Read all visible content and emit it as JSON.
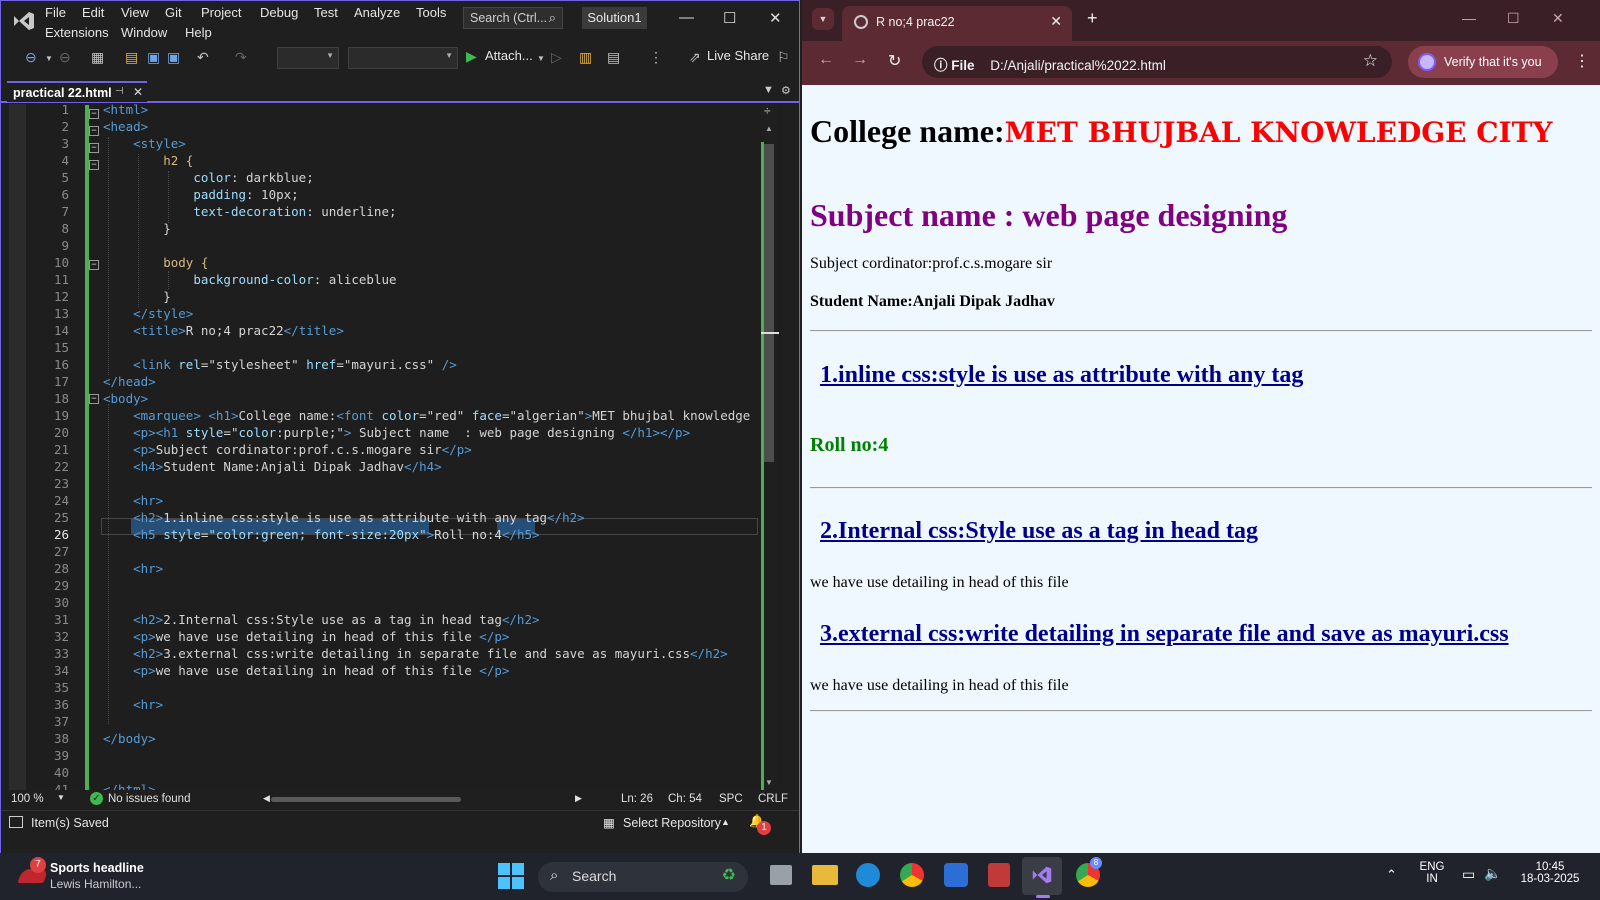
{
  "vs": {
    "menu": [
      "File",
      "Edit",
      "View",
      "Git",
      "Project",
      "Debug",
      "Test",
      "Analyze",
      "Tools",
      "Extensions",
      "Window",
      "Help"
    ],
    "search_placeholder": "Search (Ctrl...",
    "solution_label": "Solution1",
    "attach_label": "Attach...",
    "live_share_label": "Live Share",
    "doc_tab": "practical 22.html",
    "line_numbers": [
      "1",
      "2",
      "3",
      "4",
      "5",
      "6",
      "7",
      "8",
      "9",
      "10",
      "11",
      "12",
      "13",
      "14",
      "15",
      "16",
      "17",
      "18",
      "19",
      "20",
      "21",
      "22",
      "23",
      "24",
      "25",
      "26",
      "27",
      "28",
      "29",
      "30",
      "31",
      "32",
      "33",
      "34",
      "35",
      "36",
      "37",
      "38",
      "39",
      "40",
      "41"
    ],
    "code": {
      "l1": [
        "<html>"
      ],
      "l2": [
        "<head>"
      ],
      "l3": [
        "<style>"
      ],
      "l4": [
        "h2 {"
      ],
      "l5": [
        "color",
        ": darkblue;"
      ],
      "l6": [
        "padding",
        ": 10px;"
      ],
      "l7": [
        "text-decoration",
        ": underline;"
      ],
      "l8": [
        "}"
      ],
      "l10": [
        "body {"
      ],
      "l11": [
        "background-color",
        ": aliceblue"
      ],
      "l12": [
        "}"
      ],
      "l13": [
        "</style>"
      ],
      "l14": [
        "<title>",
        "R no;4 prac22",
        "</title>"
      ],
      "l16": [
        "<link ",
        "rel",
        "=",
        "\"stylesheet\"",
        " href",
        "=",
        "\"mayuri.css\"",
        " />"
      ],
      "l17": [
        "</head>"
      ],
      "l18": [
        "<body>"
      ],
      "l19": [
        "<marquee>",
        " <h1>",
        "College name:",
        "<font ",
        "color",
        "=",
        "\"red\"",
        " face",
        "=",
        "\"algerian\"",
        ">",
        "MET bhujbal knowledge c"
      ],
      "l20": [
        "<p>",
        "<h1 ",
        "style",
        "=",
        "\"",
        "color",
        ":",
        "purple",
        ";\"",
        ">",
        " Subject name  : web page designing ",
        "</h1>",
        "</p>"
      ],
      "l21": [
        "<p>",
        "Subject cordinator:prof.c.s.mogare sir",
        "</p>"
      ],
      "l22": [
        "<h4>",
        "Student Name:Anjali Dipak Jadhav",
        "</h4>"
      ],
      "l24": [
        "<hr>"
      ],
      "l25": [
        "<h2>",
        "1.inline css:style is use as attribute with any tag",
        "</h2>"
      ],
      "l26": [
        "<h5 ",
        "style",
        "=",
        "\"color:green; font-size:20px\"",
        ">",
        "Roll no:4",
        "</h5>"
      ],
      "l28": [
        "<hr>"
      ],
      "l31": [
        "<h2>",
        "2.Internal css:Style use as a tag in head tag",
        "</h2>"
      ],
      "l32": [
        "<p>",
        "we have use detailing in head of this file ",
        "</p>"
      ],
      "l33": [
        "<h2>",
        "3.external css:write detailing in separate file and save as mayuri.css",
        "</h2>"
      ],
      "l34": [
        "<p>",
        "we have use detailing in head of this file ",
        "</p>"
      ],
      "l36": [
        "<hr>"
      ],
      "l38": [
        "</body>"
      ],
      "l41": [
        "</html>"
      ]
    },
    "status": {
      "zoom": "100 %",
      "issues": "No issues found",
      "ln": "Ln: 26",
      "ch": "Ch: 54",
      "spc": "SPC",
      "crlf": "CRLF"
    },
    "bottom": {
      "saved": "Item(s) Saved",
      "repo": "Select Repository",
      "notif_count": "1"
    }
  },
  "browser": {
    "tab_title": "R no;4 prac22",
    "url_scheme": "File",
    "url": "D:/Anjali/practical%2022.html",
    "verify_label": "Verify that it's you",
    "page": {
      "college_prefix": "College name:",
      "college_name": "MET BHUJBAL KNOWLEDGE CITY",
      "subject": "Subject name : web page designing",
      "coordinator": "Subject cordinator:prof.c.s.mogare sir",
      "student": "Student Name:Anjali Dipak Jadhav",
      "h2_inline": "1.inline css:style is use as attribute with any tag",
      "roll": "Roll no:4",
      "h2_internal": "2.Internal css:Style use as a tag in head tag",
      "p_internal": "we have use detailing in head of this file",
      "h2_external": "3.external css:write detailing in separate file and save as mayuri.css",
      "p_external": "we have use detailing in head of this file"
    }
  },
  "taskbar": {
    "news_badge": "7",
    "news_title": "Sports headline",
    "news_sub": "Lewis Hamilton...",
    "search_label": "Search",
    "lang": "ENG",
    "region": "IN",
    "time": "10:45",
    "date": "18-03-2025",
    "chrome_badge": "8"
  },
  "colors": {
    "vs_accent": "#7160e8",
    "chrome_frame": "#5b2a33",
    "page_bg": "#f0f8ff"
  }
}
